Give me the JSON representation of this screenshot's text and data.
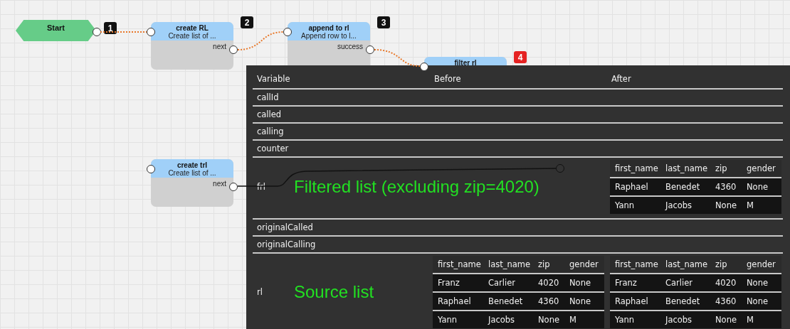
{
  "flow": {
    "nodes": [
      {
        "kind": "start",
        "title": "Start",
        "badge": {
          "label": "1",
          "current": false
        }
      },
      {
        "kind": "action",
        "title": "create RL",
        "subtitle": "Create list of ...",
        "output": "next",
        "badge": {
          "label": "2",
          "current": false
        }
      },
      {
        "kind": "action",
        "title": "append to rl",
        "subtitle": "Append row to l...",
        "output": "success",
        "badge": {
          "label": "3",
          "current": false
        }
      },
      {
        "kind": "action",
        "title": "filter rl",
        "badge": {
          "label": "4",
          "current": true
        }
      },
      {
        "kind": "action",
        "title": "create trl",
        "subtitle": "Create list of ...",
        "output": "next"
      }
    ]
  },
  "inspector": {
    "columns": [
      "Variable",
      "Before",
      "After"
    ],
    "rows": [
      {
        "name": "callId"
      },
      {
        "name": "called"
      },
      {
        "name": "calling"
      },
      {
        "name": "counter"
      },
      {
        "name": "frl",
        "note": "Filtered list (excluding zip=4020)",
        "after": {
          "columns": [
            "first_name",
            "last_name",
            "zip",
            "gender"
          ],
          "rows": [
            [
              "Raphael",
              "Benedet",
              "4360",
              "None"
            ],
            [
              "Yann",
              "Jacobs",
              "None",
              "M"
            ]
          ]
        }
      },
      {
        "name": "originalCalled"
      },
      {
        "name": "originalCalling"
      },
      {
        "name": "rl",
        "note": "Source list",
        "before": {
          "columns": [
            "first_name",
            "last_name",
            "zip",
            "gender"
          ],
          "rows": [
            [
              "Franz",
              "Carlier",
              "4020",
              "None"
            ],
            [
              "Raphael",
              "Benedet",
              "4360",
              "None"
            ],
            [
              "Yann",
              "Jacobs",
              "None",
              "M"
            ]
          ]
        },
        "after": {
          "columns": [
            "first_name",
            "last_name",
            "zip",
            "gender"
          ],
          "rows": [
            [
              "Franz",
              "Carlier",
              "4020",
              "None"
            ],
            [
              "Raphael",
              "Benedet",
              "4360",
              "None"
            ],
            [
              "Yann",
              "Jacobs",
              "None",
              "M"
            ]
          ]
        }
      }
    ]
  }
}
